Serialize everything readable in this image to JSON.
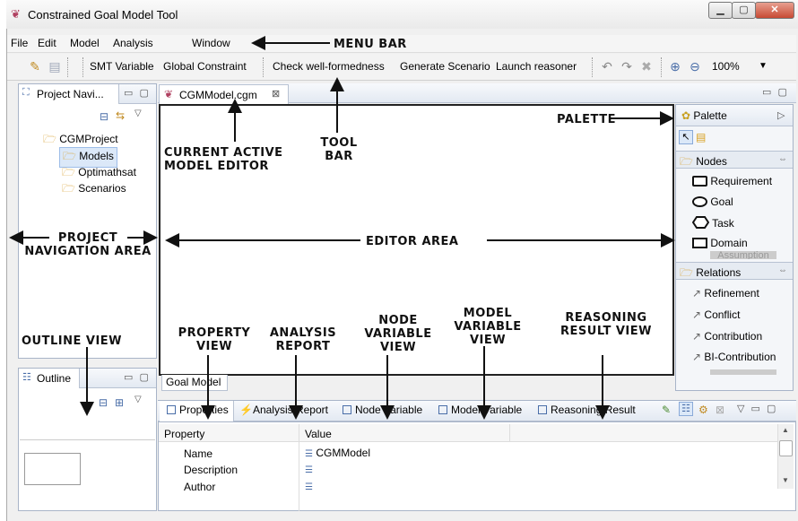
{
  "window": {
    "title": "Constrained Goal Model Tool",
    "icon": "goal-model-app-icon"
  },
  "menu": {
    "items": [
      "File",
      "Edit",
      "Model",
      "Analysis",
      "Window"
    ]
  },
  "toolbar": {
    "buttons": [
      "SMT Variable",
      "Global Constraint",
      "Check well-formedness",
      "Generate Scenario",
      "Launch reasoner"
    ],
    "zoom": "100%"
  },
  "project_nav": {
    "tab_label": "Project Navi...",
    "root": "CGMProject",
    "folders": [
      "Models",
      "Optimathsat",
      "Scenarios"
    ]
  },
  "outline": {
    "tab_label": "Outline"
  },
  "editor": {
    "tab_label": "CGMModel.cgm",
    "bottom_tab": "Goal Model"
  },
  "palette": {
    "title": "Palette",
    "nodes_header": "Nodes",
    "nodes": [
      "Requirement",
      "Goal",
      "Task",
      "Domain",
      "Assumption"
    ],
    "relations_header": "Relations",
    "relations": [
      "Refinement",
      "Conflict",
      "Contribution",
      "BI-Contribution"
    ]
  },
  "bottom_view": {
    "tabs": [
      "Properties",
      "Analysis Report",
      "Node Variable",
      "Model Variable",
      "Reasoning Result"
    ],
    "columns": [
      "Property",
      "Value"
    ],
    "rows": [
      {
        "property": "Name",
        "value": "CGMModel"
      },
      {
        "property": "Description",
        "value": ""
      },
      {
        "property": "Author",
        "value": ""
      }
    ]
  },
  "annotations": {
    "menu_bar": "MENU BAR",
    "palette": "PALETTE",
    "current_editor": "CURRENT ACTIVE MODEL EDITOR",
    "tool_bar": "TOOL BAR",
    "project_nav": "PROJECT NAVIGATION AREA",
    "editor_area": "EDITOR AREA",
    "outline_view": "OUTLINE VIEW",
    "property_view": "PROPERTY VIEW",
    "analysis_report": "ANALYSIS REPORT",
    "node_variable": "NODE VARIABLE VIEW",
    "model_variable": "MODEL VARIABLE VIEW",
    "reasoning_result": "REASONING RESULT VIEW"
  }
}
